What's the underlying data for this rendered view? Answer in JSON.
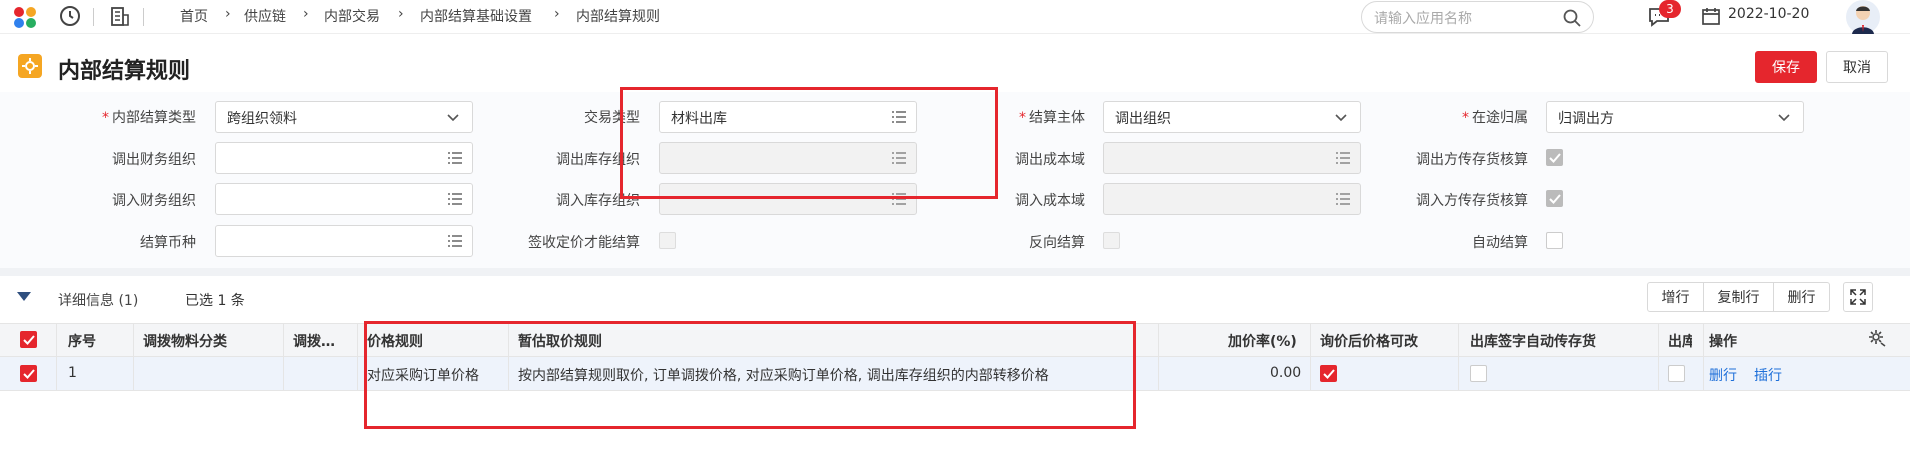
{
  "header": {
    "breadcrumb": [
      "首页",
      "供应链",
      "内部交易",
      "内部结算基础设置",
      "内部结算规则"
    ],
    "search_placeholder": "请输入应用名称",
    "notification_count": "3",
    "date": "2022-10-20"
  },
  "page": {
    "title": "内部结算规则",
    "save_label": "保存",
    "cancel_label": "取消"
  },
  "form": {
    "settlement_type": {
      "label": "内部结算类型",
      "value": "跨组织领料"
    },
    "transaction_type": {
      "label": "交易类型",
      "value": "材料出库"
    },
    "settlement_subject": {
      "label": "结算主体",
      "value": "调出组织"
    },
    "in_transit": {
      "label": "在途归属",
      "value": "归调出方"
    },
    "out_finance_org": {
      "label": "调出财务组织",
      "value": ""
    },
    "out_stock_org": {
      "label": "调出库存组织",
      "value": ""
    },
    "out_cost_domain": {
      "label": "调出成本域",
      "value": ""
    },
    "out_pass_stock": {
      "label": "调出方传存货核算"
    },
    "in_finance_org": {
      "label": "调入财务组织",
      "value": ""
    },
    "in_stock_org": {
      "label": "调入库存组织",
      "value": ""
    },
    "in_cost_domain": {
      "label": "调入成本域",
      "value": ""
    },
    "in_pass_stock": {
      "label": "调入方传存货核算"
    },
    "currency": {
      "label": "结算币种",
      "value": ""
    },
    "sign_price": {
      "label": "签收定价才能结算"
    },
    "reverse": {
      "label": "反向结算"
    },
    "auto": {
      "label": "自动结算"
    }
  },
  "detail": {
    "section_label": "详细信息 (1)",
    "selected_label": "已选 1 条",
    "add_row": "增行",
    "copy_row": "复制行",
    "delete_row": "删行",
    "columns": [
      "序号",
      "调拨物料分类",
      "调拨…",
      "价格规则",
      "暂估取价规则",
      "加价率(%)",
      "询价后价格可改",
      "出库签字自动传存货",
      "出库",
      "操作"
    ],
    "rows": [
      {
        "index": "1",
        "category": "",
        "transfer": "",
        "price_rule": "对应采购订单价格",
        "estimate_rule": "按内部结算规则取价, 订单调拨价格, 对应采购订单价格, 调出库存组织的内部转移价格",
        "markup": "0.00",
        "actions": [
          "删行",
          "插行"
        ]
      }
    ]
  },
  "colors": {
    "accent": "#e5262d",
    "link": "#1e6fd9"
  }
}
